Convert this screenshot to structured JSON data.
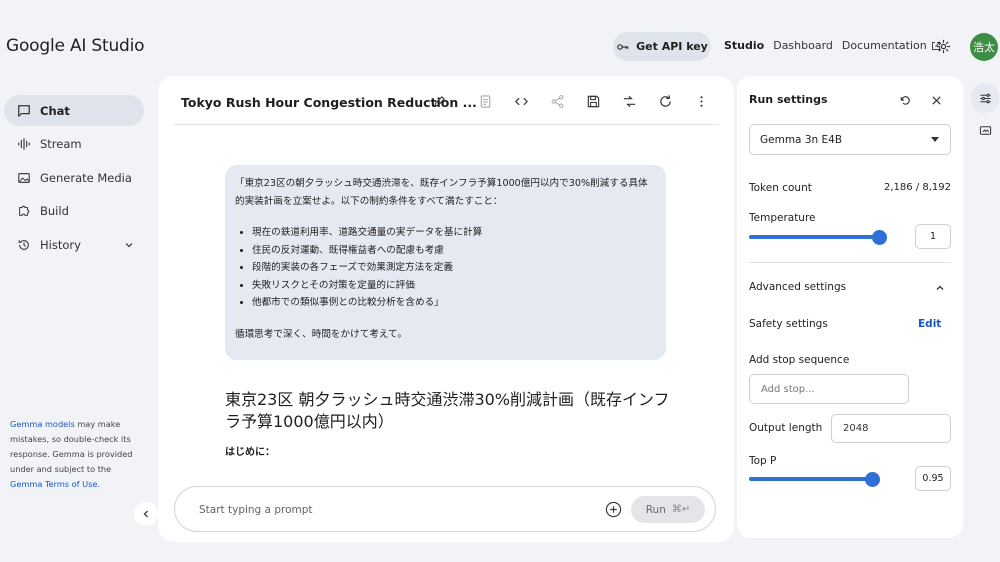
{
  "app": {
    "logo": "Google AI Studio"
  },
  "sidebar": {
    "items": [
      {
        "label": "Chat",
        "icon": "chat-icon",
        "active": true
      },
      {
        "label": "Stream",
        "icon": "waveform-icon"
      },
      {
        "label": "Generate Media",
        "icon": "image-icon"
      },
      {
        "label": "Build",
        "icon": "puzzle-icon"
      },
      {
        "label": "History",
        "icon": "history-icon"
      }
    ],
    "disclaimer": {
      "link1": "Gemma models",
      "text1": " may make mistakes, so double-check its response. Gemma is provided under and subject to the ",
      "link2": "Gemma Terms of Use",
      "text2": "."
    }
  },
  "header": {
    "api_key_label": "Get API key",
    "links": {
      "studio": "Studio",
      "dashboard": "Dashboard",
      "documentation": "Documentation"
    },
    "avatar_text": "浩太",
    "avatar_color": "#3d8d45"
  },
  "chat": {
    "title": "Tokyo Rush Hour Congestion Reduction ...",
    "user_message": {
      "intro": "「東京23区の朝夕ラッシュ時交通渋滞を、既存インフラ予算1000億円以内で30%削減する具体的実装計画を立案せよ。以下の制約条件をすべて満たすこと：",
      "bullets": [
        "現在の鉄道利用率、道路交通量の実データを基に計算",
        "住民の反対運動、既得権益者への配慮も考慮",
        "段階的実装の各フェーズで効果測定方法を定義",
        "失敗リスクとその対策を定量的に評価",
        "他都市での類似事例との比較分析を含める」"
      ],
      "closing": "循環思考で深く、時間をかけて考えて。"
    },
    "response": {
      "title": "東京23区 朝夕ラッシュ時交通渋滞30%削減計画（既存インフラ予算1000億円以内）",
      "subtitle": "はじめに："
    },
    "prompt": {
      "placeholder": "Start typing a prompt",
      "run_label": "Run",
      "run_shortcut": "⌘↵"
    }
  },
  "settings": {
    "title": "Run settings",
    "model": "Gemma 3n E4B",
    "token_count_label": "Token count",
    "token_count_value": "2,186 / 8,192",
    "temperature_label": "Temperature",
    "temperature_value": "1",
    "temperature_fraction": 1.0,
    "advanced_label": "Advanced settings",
    "safety_label": "Safety settings",
    "safety_edit": "Edit",
    "stop_sequence_label": "Add stop sequence",
    "stop_sequence_placeholder": "Add stop...",
    "output_length_label": "Output length",
    "output_length_value": "2048",
    "top_p_label": "Top P",
    "top_p_value": "0.95",
    "top_p_fraction": 0.95,
    "accent_color": "#2f6fd8"
  }
}
